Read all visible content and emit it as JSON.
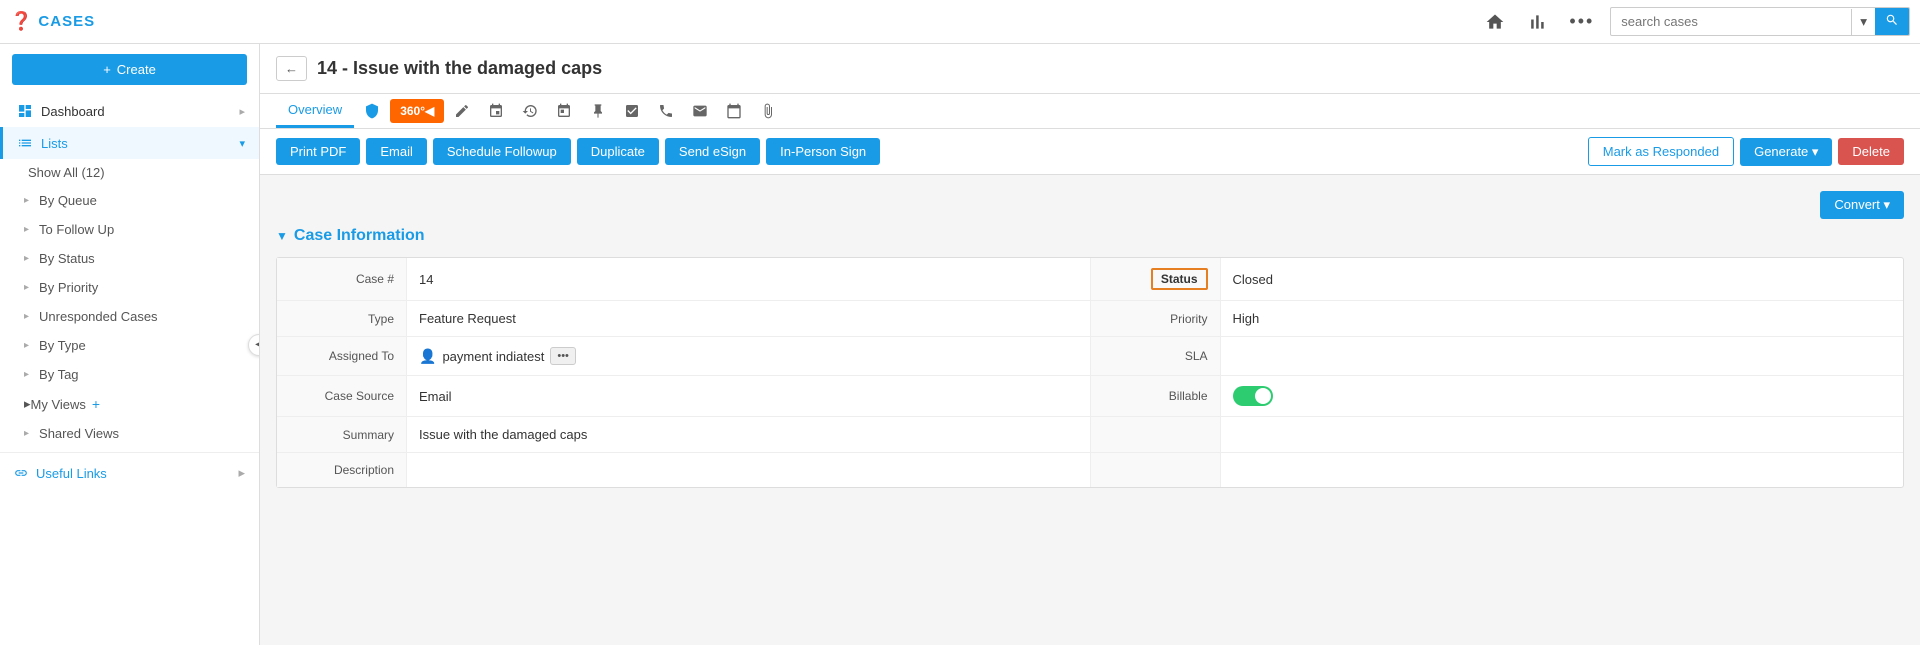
{
  "app": {
    "title": "CASES",
    "logo_icon": "question-circle-icon"
  },
  "topnav": {
    "home_icon": "home-icon",
    "chart_icon": "chart-icon",
    "more_icon": "more-icon",
    "search_placeholder": "search cases",
    "dropdown_icon": "chevron-down-icon",
    "search_icon": "search-icon"
  },
  "sidebar": {
    "create_label": "Create",
    "nav_items": [
      {
        "id": "dashboard",
        "label": "Dashboard",
        "active": false,
        "has_arrow": true
      },
      {
        "id": "lists",
        "label": "Lists",
        "active": true,
        "has_arrow": true
      }
    ],
    "list_sub_items": [
      {
        "id": "show-all",
        "label": "Show All (12)"
      },
      {
        "id": "by-queue",
        "label": "By Queue"
      },
      {
        "id": "to-follow-up",
        "label": "To Follow Up"
      },
      {
        "id": "by-status",
        "label": "By Status"
      },
      {
        "id": "by-priority",
        "label": "By Priority"
      },
      {
        "id": "unresponded-cases",
        "label": "Unresponded Cases"
      },
      {
        "id": "by-type",
        "label": "By Type"
      },
      {
        "id": "by-tag",
        "label": "By Tag"
      },
      {
        "id": "my-views",
        "label": "My Views"
      },
      {
        "id": "shared-views",
        "label": "Shared Views"
      }
    ],
    "useful_links_label": "Useful Links",
    "collapse_icon": "collapse-left-icon"
  },
  "case": {
    "back_icon": "back-arrow-icon",
    "title": "14 - Issue with the damaged caps",
    "tabs": [
      {
        "id": "overview",
        "label": "Overview",
        "active": true
      },
      {
        "id": "shield",
        "icon": "shield-icon"
      },
      {
        "id": "360",
        "label": "360°",
        "special": true
      },
      {
        "id": "edit",
        "icon": "edit-icon"
      },
      {
        "id": "schedule",
        "icon": "schedule-icon"
      },
      {
        "id": "history",
        "icon": "history-icon"
      },
      {
        "id": "calendar",
        "icon": "calendar-icon"
      },
      {
        "id": "pin",
        "icon": "pin-icon"
      },
      {
        "id": "checklist",
        "icon": "checklist-icon"
      },
      {
        "id": "phone",
        "icon": "phone-icon"
      },
      {
        "id": "email-tab",
        "icon": "email-icon"
      },
      {
        "id": "calendar2",
        "icon": "calendar2-icon"
      },
      {
        "id": "attachment",
        "icon": "attachment-icon"
      }
    ],
    "action_buttons": [
      {
        "id": "print-pdf",
        "label": "Print PDF",
        "type": "blue"
      },
      {
        "id": "email",
        "label": "Email",
        "type": "blue"
      },
      {
        "id": "schedule-followup",
        "label": "Schedule Followup",
        "type": "blue"
      },
      {
        "id": "duplicate",
        "label": "Duplicate",
        "type": "blue"
      },
      {
        "id": "send-esign",
        "label": "Send eSign",
        "type": "blue"
      },
      {
        "id": "in-person-sign",
        "label": "In-Person Sign",
        "type": "blue"
      }
    ],
    "right_buttons": [
      {
        "id": "mark-as-responded",
        "label": "Mark as Responded"
      },
      {
        "id": "generate",
        "label": "Generate ▾"
      },
      {
        "id": "delete",
        "label": "Delete"
      }
    ],
    "convert_label": "Convert ▾",
    "section_title": "Case Information",
    "fields": {
      "case_number_label": "Case #",
      "case_number_value": "14",
      "type_label": "Type",
      "type_value": "Feature Request",
      "assigned_to_label": "Assigned To",
      "assigned_to_value": "payment indiatest",
      "case_source_label": "Case Source",
      "case_source_value": "Email",
      "summary_label": "Summary",
      "summary_value": "Issue with the damaged caps",
      "description_label": "Description",
      "description_value": "",
      "status_label": "Status",
      "status_value": "Closed",
      "priority_label": "Priority",
      "priority_value": "High",
      "sla_label": "SLA",
      "sla_value": "",
      "billable_label": "Billable",
      "billable_value": true
    }
  }
}
